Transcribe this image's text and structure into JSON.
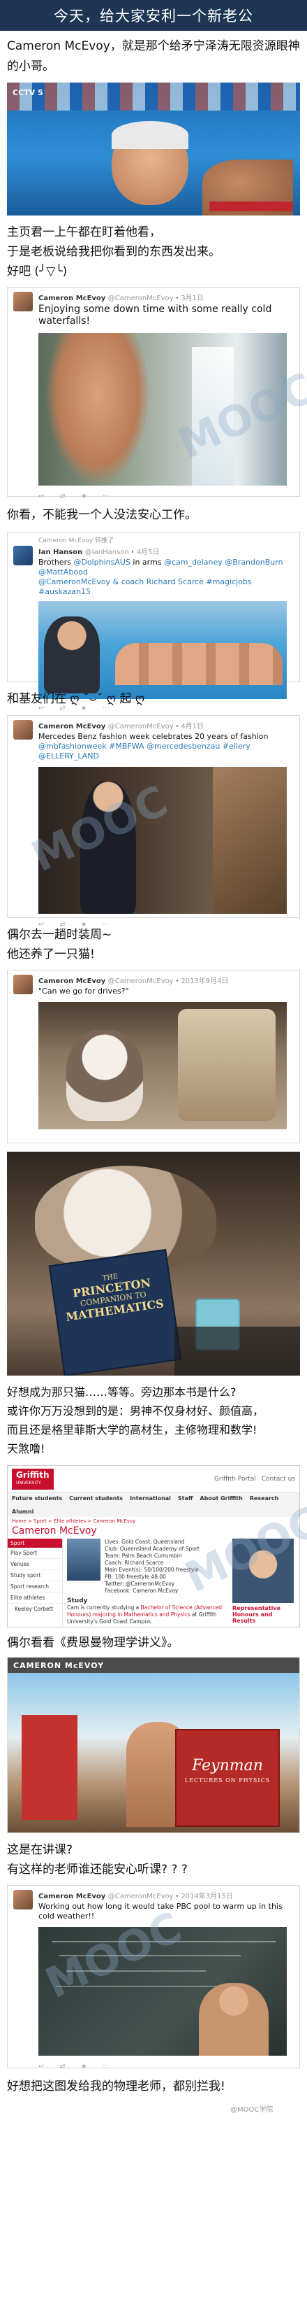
{
  "header": {
    "title": "今天，给大家安利一个新老公"
  },
  "caption1": "Cameron McEvoy，就是那个给矛宁泽涛无限资源眼神的小哥。",
  "caption2_line1": "主页君一上午都在盯着他看，",
  "caption2_line2": "于是老板说给我把你看到的东西发出来。",
  "caption3": "好吧 (╯▽╰)",
  "tweet1": {
    "name": "Cameron McEvoy",
    "handle": "@CameronMcEvoy",
    "date": "3月1日",
    "text": "Enjoying some down time with some really cold waterfalls!"
  },
  "caption4": "你看，不能我一个人没法安心工作。",
  "tweet2": {
    "retweet_by": "Cameron McEvoy 转推了",
    "name": "Ian Hanson",
    "handle": "@IanHanson",
    "date": "4月5日",
    "text_a": "Brothers ",
    "text_b": "@DolphinsAUS",
    "text_c": " in arms ",
    "text_d": "@cam_delaney @BrandonBurn @MattAbood",
    "text_e": "@CameronMcEvoy & coach Richard Scarce ",
    "text_f": "#magicjobs #auskazan15"
  },
  "caption5": "和基友们在 ღ ˘⌣˘ ღ 起 ღ",
  "tweet3": {
    "name": "Cameron McEvoy",
    "handle": "@CameronMcEvoy",
    "date": "4月1日",
    "text_a": "Mercedes Benz fashion week celebrates 20 years of fashion ",
    "text_b": "@mbfashionweek #MBFWA @mercedesbenzau #ellery",
    "text_c": "@ELLERY_LAND"
  },
  "caption6_line1": "偶尔去一趟时装周~",
  "caption6_line2": "他还养了一只猫!",
  "tweet4": {
    "name": "Cameron McEvoy",
    "handle": "@CameronMcEvoy",
    "date": "2013年9月4日",
    "text": "\"Can we go for drives?\""
  },
  "book": {
    "title_a": "THE",
    "title_b": "PRINCETON",
    "title_c": "COMPANION TO",
    "title_d": "MATHEMATICS"
  },
  "caption7_line1": "好想成为那只猫……等等。旁边那本书是什么?",
  "caption7_line2": "或许你万万没想到的是：男神不仅身材好、颜值高，",
  "caption7_line3": "而且还是格里菲斯大学的高材生，主修物理和数学!",
  "caption7_line4": "天煞噜!",
  "web": {
    "logo": "Griffith",
    "logo_sub": "UNIVERSITY",
    "nav": [
      "Future students",
      "Current students",
      "International",
      "Staff",
      "About Griffith",
      "Research",
      "Alumni"
    ],
    "top_links": [
      "Griffith Portal",
      "Contact us"
    ],
    "breadcrumb": "Home > Sport > Elite athletes > Cameron McEvoy",
    "page_title": "Cameron McEvoy",
    "side": [
      "Sport",
      "Play Sport",
      "Venues",
      "Study sport",
      "Sport research",
      "Elite athletes",
      "Keeley Corbett"
    ],
    "profile": [
      "Lives: Gold Coast, Queensland",
      "Club: Queensland Academy of Sport",
      "Team: Palm Beach Currumbin",
      "Coach: Richard Scarce",
      "Main Event(s): 50/100/200 freestyle",
      "PB: 100 freestyle 48.00",
      "Twitter: @CameronMcEvoy",
      "Facebook: Cameron McEvoy"
    ],
    "study_title": "Study",
    "study_text_a": "Cam is currently studying a ",
    "study_text_b": "Bachelor of Science (Advanced Honours) majoring in Mathematics and Physics",
    "study_text_c": " at Griffith University's Gold Coast Campus.",
    "right_label_a": "Representative",
    "right_label_b": "Honours and Results"
  },
  "caption8": "偶尔看看《费恩曼物理学讲义》。",
  "insta": {
    "header": "CAMERON McEVOY",
    "book_title": "Feynman",
    "book_sub": "LECTURES ON PHYSICS"
  },
  "caption9_line1": "这是在讲课?",
  "caption9_line2": "有这样的老师谁还能安心听课? ? ?",
  "tweet5": {
    "name": "Cameron McEvoy",
    "handle": "@CameronMcEvoy",
    "date": "2014年3月15日",
    "text": "Working out how long it would take PBC pool to warm up in this cold weather!!"
  },
  "caption10": "好想把这图发给我的物理老师，都别拦我!",
  "footer_mark": "@MOOC学院",
  "watermark": "MOOC"
}
